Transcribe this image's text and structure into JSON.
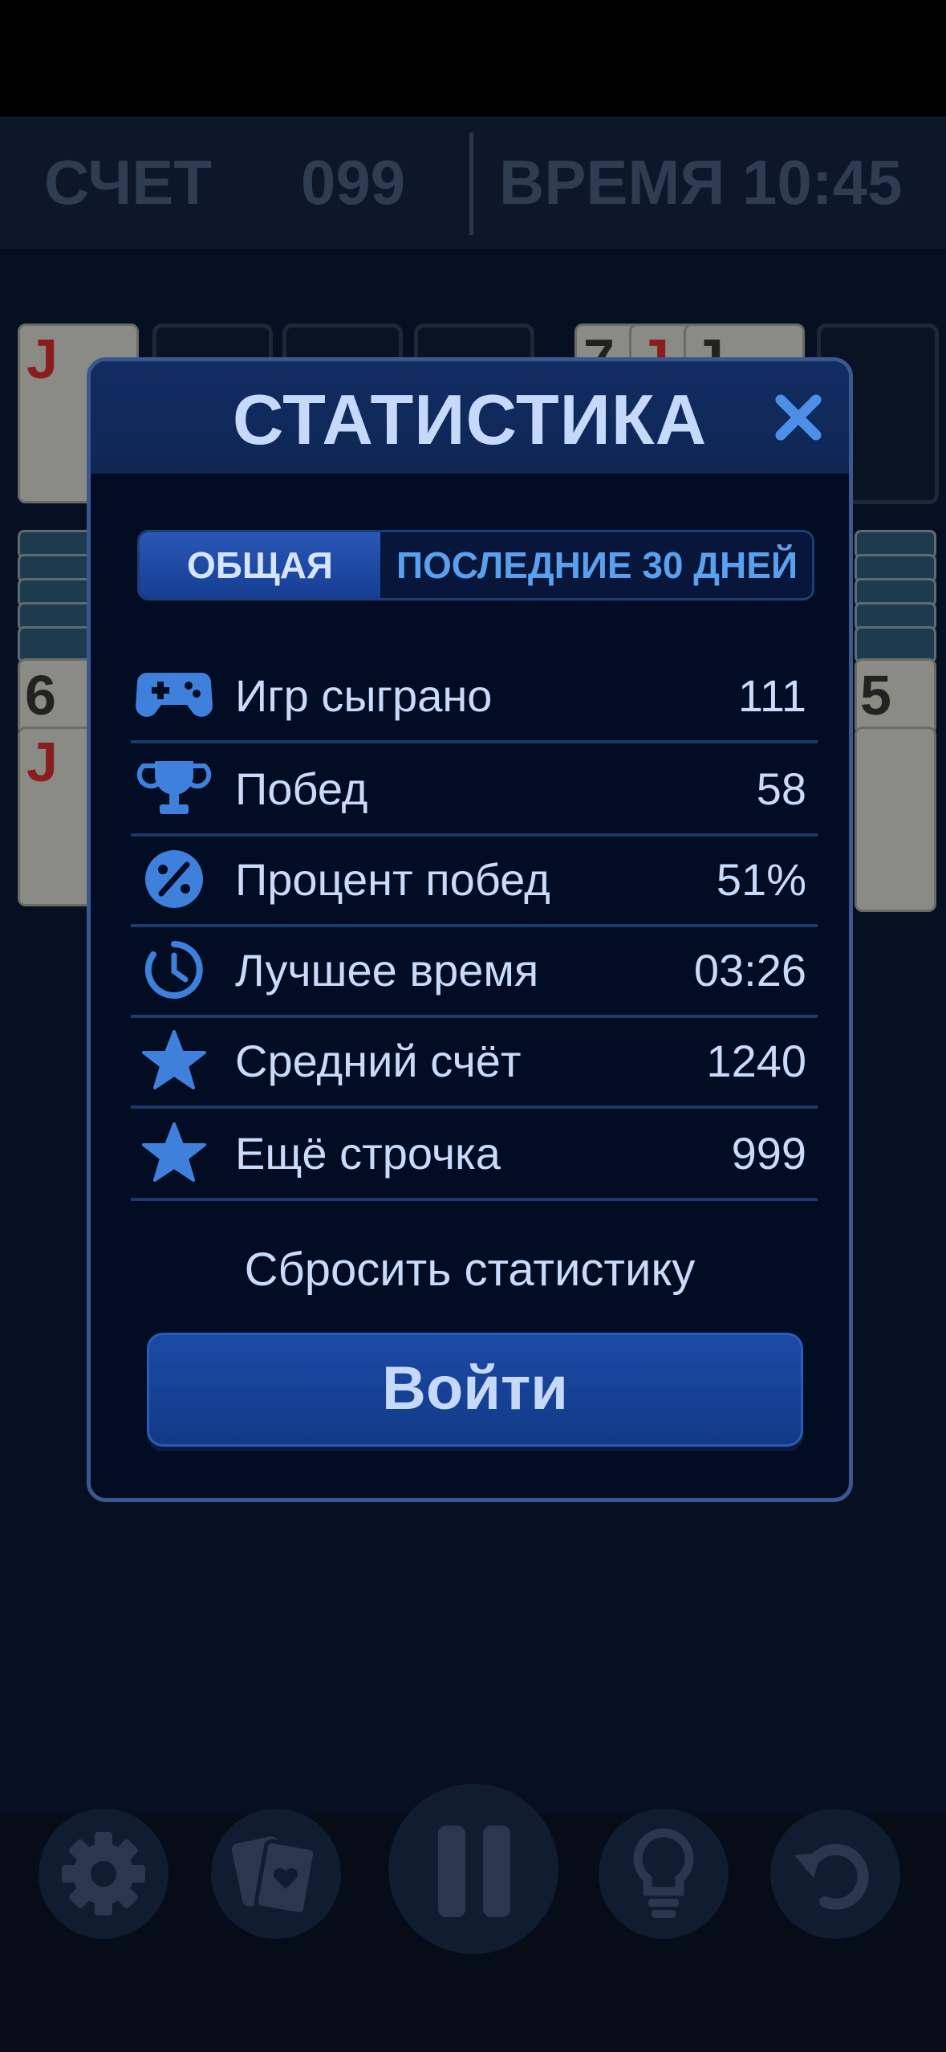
{
  "scorebar": {
    "score_label": "СЧЕТ",
    "score_value": "099",
    "time_label": "ВРЕМЯ",
    "time_value": "10:45"
  },
  "board": {
    "ranks": [
      "J",
      "6",
      "J",
      "7",
      "J",
      "J",
      "5"
    ]
  },
  "modal": {
    "title": "СТАТИСТИКА",
    "tabs": [
      {
        "label": "ОБЩАЯ",
        "active": true
      },
      {
        "label": "ПОСЛЕДНИЕ 30 ДНЕЙ",
        "active": false
      }
    ],
    "stats": [
      {
        "icon": "gamepad-icon",
        "label": "Игр сыграно",
        "value": "111"
      },
      {
        "icon": "trophy-icon",
        "label": "Побед",
        "value": "58"
      },
      {
        "icon": "percent-icon",
        "label": "Процент побед",
        "value": "51%"
      },
      {
        "icon": "clock-icon",
        "label": "Лучшее время",
        "value": "03:26"
      },
      {
        "icon": "star-icon",
        "label": "Средний счёт",
        "value": "1240"
      },
      {
        "icon": "star-icon",
        "label": "Ещё строчка",
        "value": "999"
      }
    ],
    "reset_label": "Сбросить статистику",
    "login_label": "Войти"
  },
  "controls": [
    "settings-icon",
    "cards-icon",
    "pause-icon",
    "hint-icon",
    "undo-icon"
  ],
  "colors": {
    "accent": "#3f80dd",
    "text": "#c9dbf8",
    "modal_bg": "#020d24",
    "border": "#3a5790"
  }
}
